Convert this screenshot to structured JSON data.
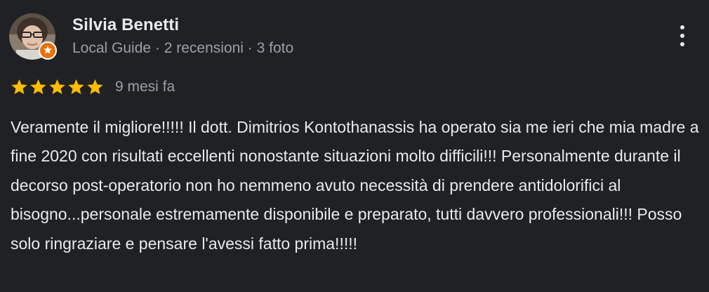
{
  "review": {
    "reviewer_name": "Silvia Benetti",
    "reviewer_meta": "Local Guide · 2 recensioni · 3 foto",
    "rating": 5,
    "rating_max": 5,
    "date": "9 mesi fa",
    "text": "Veramente il migliore!!!!! Il dott. Dimitrios Kontothanassis ha operato sia me ieri che mia madre a fine 2020 con risultati eccellenti nonostante situazioni molto difficili!!! Personalmente durante il decorso post-operatorio non ho nemmeno avuto necessità di prendere antidolorifici al bisogno...personale estremamente disponibile e preparato, tutti davvero professionali!!! Posso solo ringraziare e pensare l'avessi fatto prima!!!!!"
  },
  "icons": {
    "avatar": "avatar-photo",
    "badge": "local-guide-badge-icon",
    "more": "more-vertical-icon",
    "star": "star-icon"
  },
  "colors": {
    "background": "#202124",
    "text_primary": "#e8eaed",
    "text_secondary": "#9aa0a6",
    "star": "#fbbc04",
    "badge": "#e8710a"
  }
}
